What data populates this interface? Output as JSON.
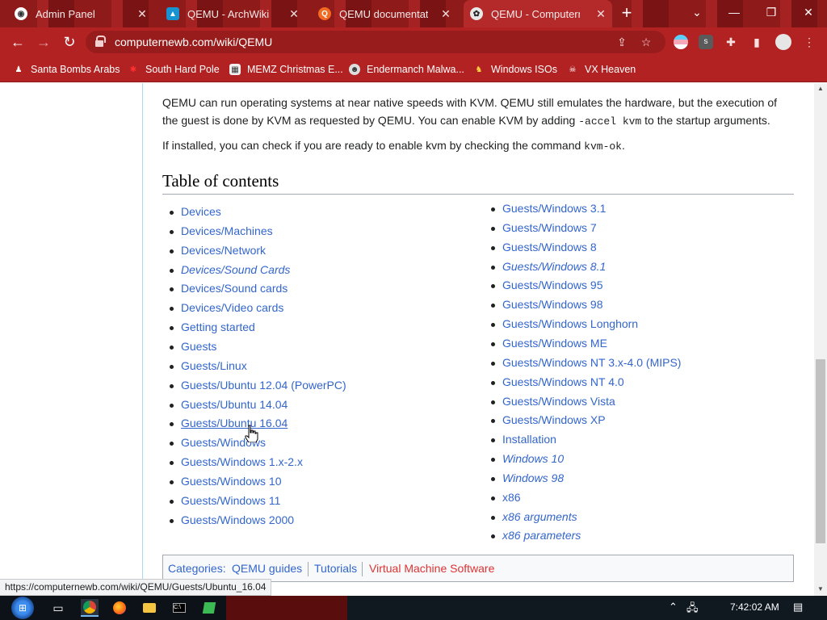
{
  "tabs": [
    {
      "title": "Admin Panel",
      "active": false
    },
    {
      "title": "QEMU - ArchWiki",
      "active": false
    },
    {
      "title": "QEMU documentation",
      "active": false
    },
    {
      "title": "QEMU - Computernewb",
      "active": true
    }
  ],
  "window_controls": {
    "dropdown": "⌄",
    "minimize": "—",
    "restore": "❐",
    "close": "✕"
  },
  "toolbar": {
    "url": "computernewb.com/wiki/QEMU"
  },
  "bookmarks": [
    "Santa Bombs Arabs",
    "South Hard Pole",
    "MEMZ Christmas E...",
    "Endermanch Malwa...",
    "Windows ISOs",
    "VX Heaven"
  ],
  "article": {
    "para1_a": "QEMU can run operating systems at near native speeds with KVM. QEMU still emulates the hardware, but the execution of",
    "para1_b": "the guest is done by KVM as requested by QEMU. You can enable KVM by adding",
    "para1_code": "-accel kvm",
    "para1_c": "to the startup arguments.",
    "para2_a": "If installed, you can check if you are ready to enable kvm by checking the command",
    "para2_code": "kvm-ok",
    "para2_b": ".",
    "toc_title": "Table of contents",
    "toc_left": [
      {
        "label": "Devices",
        "italic": false
      },
      {
        "label": "Devices/Machines",
        "italic": false
      },
      {
        "label": "Devices/Network",
        "italic": false
      },
      {
        "label": "Devices/Sound Cards",
        "italic": true
      },
      {
        "label": "Devices/Sound cards",
        "italic": false
      },
      {
        "label": "Devices/Video cards",
        "italic": false
      },
      {
        "label": "Getting started",
        "italic": false
      },
      {
        "label": "Guests",
        "italic": false
      },
      {
        "label": "Guests/Linux",
        "italic": false
      },
      {
        "label": "Guests/Ubuntu 12.04 (PowerPC)",
        "italic": false
      },
      {
        "label": "Guests/Ubuntu 14.04",
        "italic": false
      },
      {
        "label": "Guests/Ubuntu 16.04",
        "italic": false,
        "hovered": true
      },
      {
        "label": "Guests/Windows",
        "italic": false
      },
      {
        "label": "Guests/Windows 1.x-2.x",
        "italic": false
      },
      {
        "label": "Guests/Windows 10",
        "italic": false
      },
      {
        "label": "Guests/Windows 11",
        "italic": false
      },
      {
        "label": "Guests/Windows 2000",
        "italic": false
      }
    ],
    "toc_right": [
      {
        "label": "Guests/Windows 3.1",
        "italic": false
      },
      {
        "label": "Guests/Windows 7",
        "italic": false
      },
      {
        "label": "Guests/Windows 8",
        "italic": false
      },
      {
        "label": "Guests/Windows 8.1",
        "italic": true
      },
      {
        "label": "Guests/Windows 95",
        "italic": false
      },
      {
        "label": "Guests/Windows 98",
        "italic": false
      },
      {
        "label": "Guests/Windows Longhorn",
        "italic": false
      },
      {
        "label": "Guests/Windows ME",
        "italic": false
      },
      {
        "label": "Guests/Windows NT 3.x-4.0 (MIPS)",
        "italic": false
      },
      {
        "label": "Guests/Windows NT 4.0",
        "italic": false
      },
      {
        "label": "Guests/Windows Vista",
        "italic": false
      },
      {
        "label": "Guests/Windows XP",
        "italic": false
      },
      {
        "label": "Installation",
        "italic": false
      },
      {
        "label": "Windows 10",
        "italic": true
      },
      {
        "label": "Windows 98",
        "italic": true
      },
      {
        "label": "x86",
        "italic": false
      },
      {
        "label": "x86 arguments",
        "italic": true
      },
      {
        "label": "x86 parameters",
        "italic": true
      }
    ],
    "categories": {
      "label": "Categories:",
      "items": [
        "QEMU guides",
        "Tutorials",
        "Virtual Machine Software"
      ],
      "missing_color": "#d33"
    }
  },
  "status_url": "https://computernewb.com/wiki/QEMU/Guests/Ubuntu_16.04",
  "taskbar": {
    "clock": "7:42:02 AM"
  },
  "colors": {
    "link": "#3366cc",
    "text": "#202122",
    "browser_theme": "#b22222"
  }
}
